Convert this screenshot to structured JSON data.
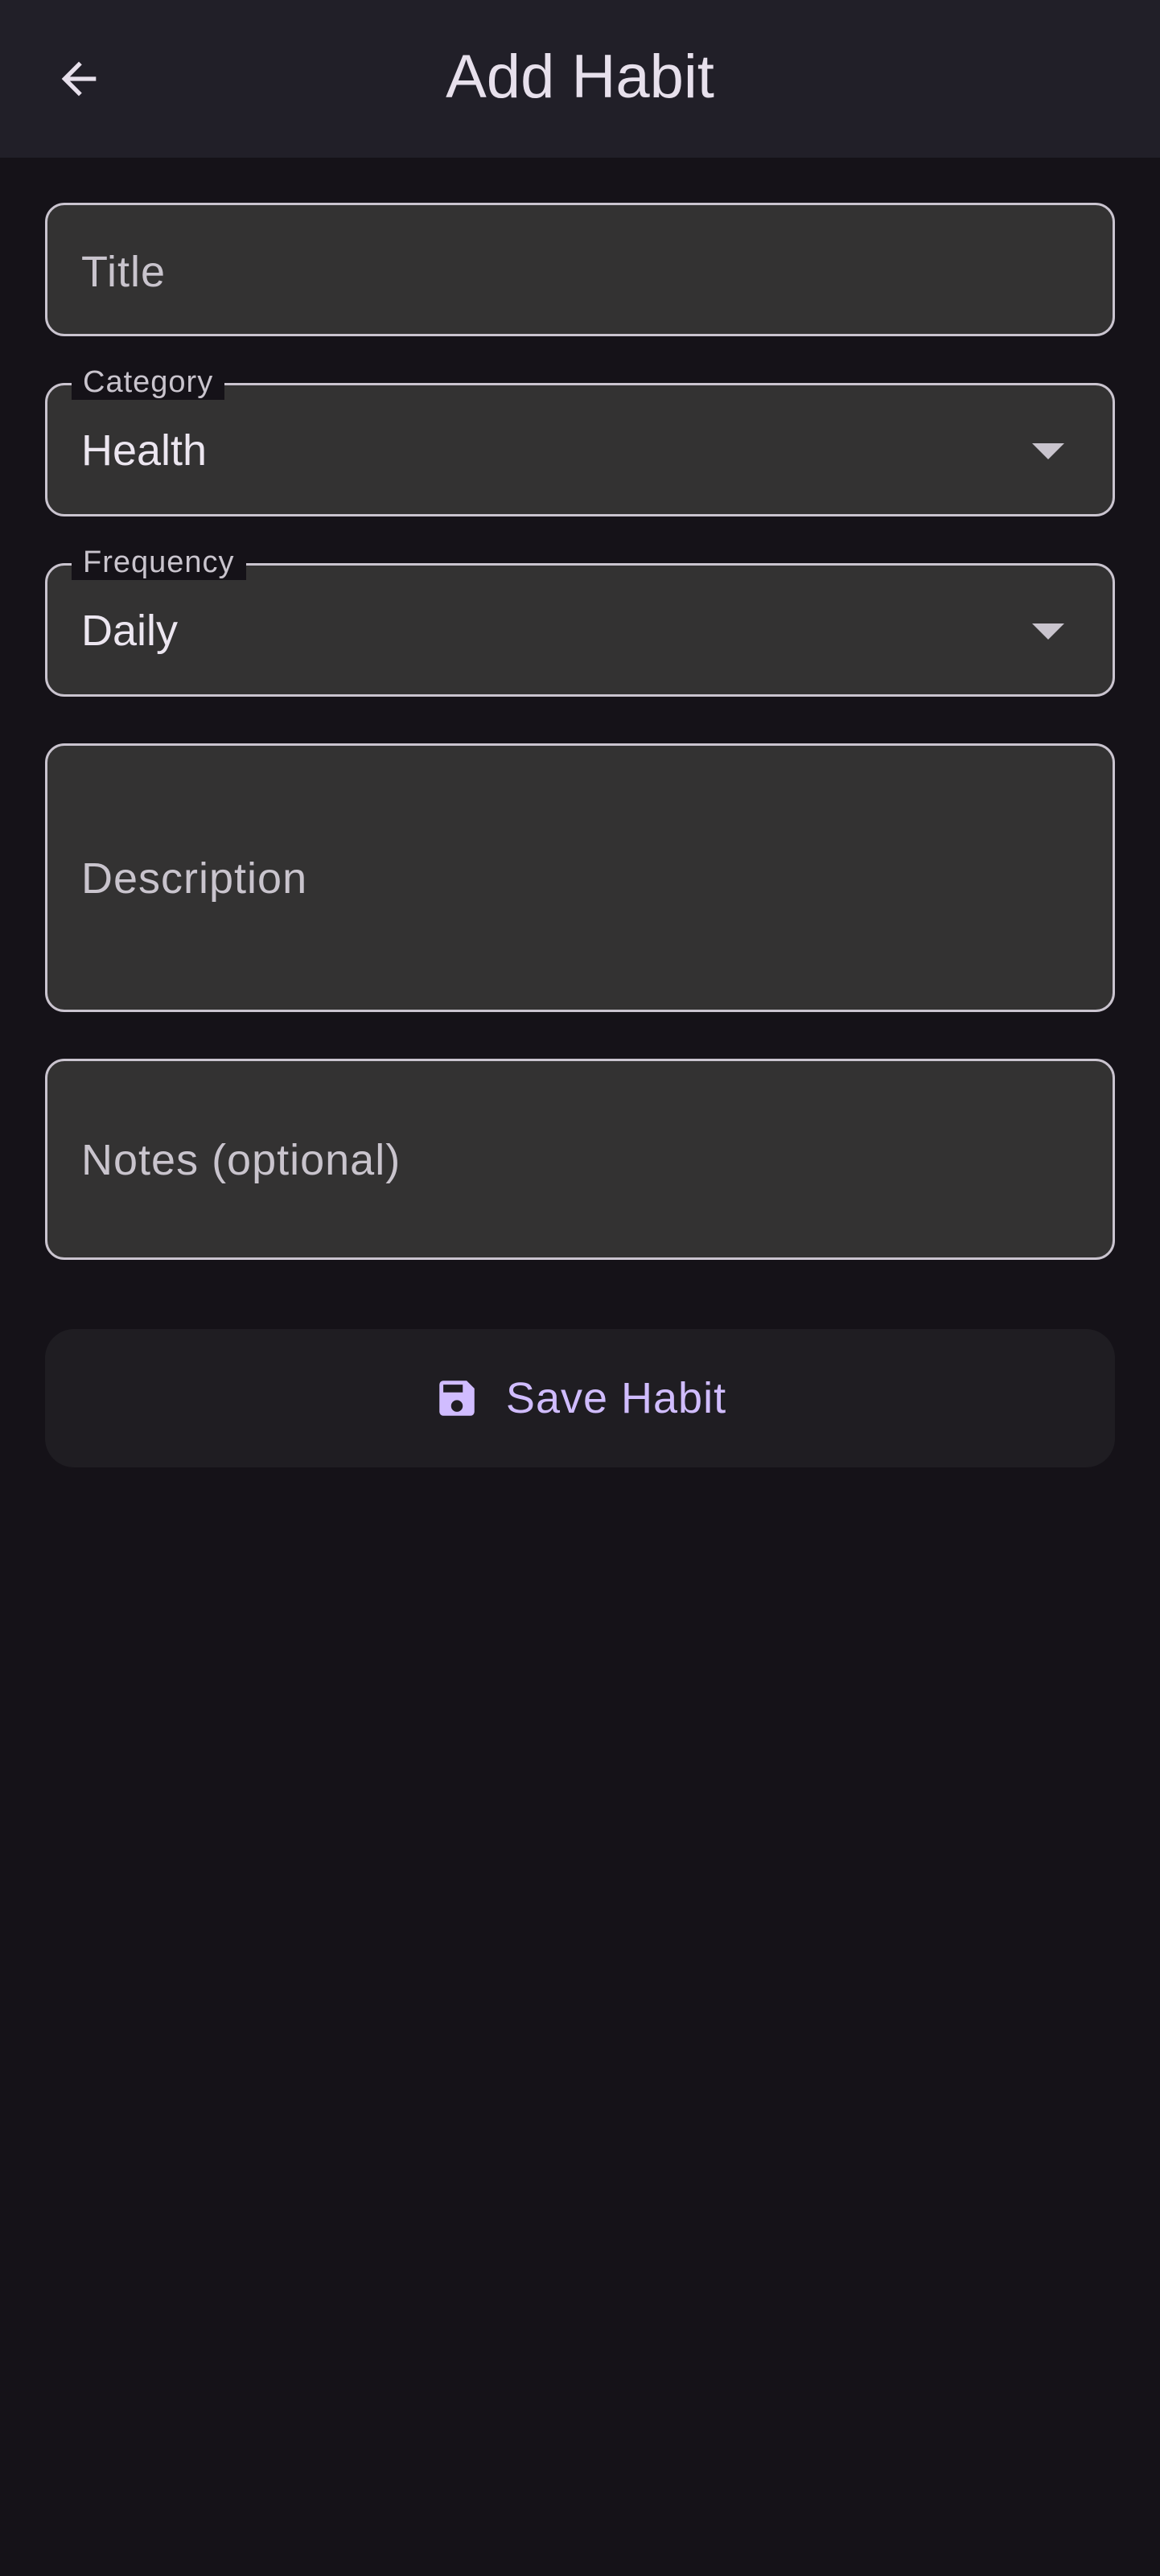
{
  "appbar": {
    "title": "Add Habit",
    "back_icon": "arrow-left-icon"
  },
  "form": {
    "title_field": {
      "placeholder": "Title",
      "value": ""
    },
    "category_field": {
      "label": "Category",
      "value": "Health"
    },
    "frequency_field": {
      "label": "Frequency",
      "value": "Daily"
    },
    "description_field": {
      "placeholder": "Description",
      "value": ""
    },
    "notes_field": {
      "placeholder": "Notes (optional)",
      "value": ""
    }
  },
  "save_button": {
    "label": "Save Habit",
    "icon": "save-icon"
  },
  "colors": {
    "background": "#151218",
    "appbar": "#211f28",
    "field_fill": "#333232",
    "field_border": "#cac4cf",
    "accent": "#d0bcff"
  }
}
